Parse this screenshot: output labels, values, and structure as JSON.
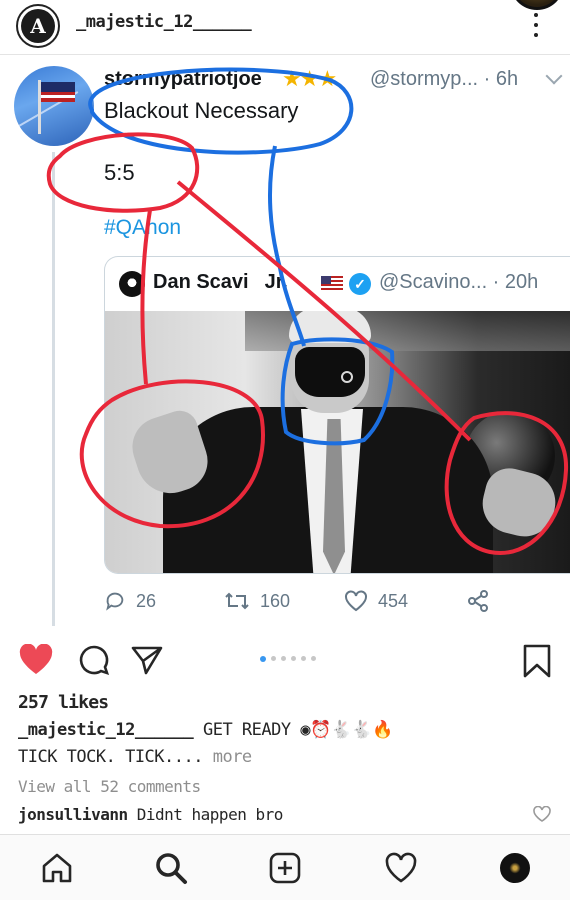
{
  "post_header": {
    "username": "_majestic_12______",
    "avatar_letter": "A"
  },
  "tweet": {
    "name": "stormypatriotjoe",
    "stars": "★★★",
    "handle_time": "@stormyp... · 6h",
    "line1": "Blackout Necessary",
    "line2": "5:5",
    "hashtag": "#QAnon",
    "quoted": {
      "name": "Dan Scavi",
      "name_suffix": "Jr.",
      "handle_time": "@Scavino... · 20h"
    },
    "actions": {
      "replies": "26",
      "retweets": "160",
      "likes": "454"
    }
  },
  "post": {
    "likes": "257 likes",
    "caption_user": "_majestic_12______",
    "caption_text": "GET READY",
    "caption_emojis": "◉⏰🐇🐇🔥",
    "caption_line2": "TICK TOCK. TICK....",
    "more": "more",
    "view_comments": "View all 52 comments",
    "comment_user": "jonsullivann",
    "comment_text": "Didnt happen bro"
  },
  "carousel": {
    "count": 6,
    "active": 0
  },
  "colors": {
    "heart_red": "#ed4956",
    "annotation_red": "#e8283a",
    "annotation_blue": "#1c6fe0",
    "link_blue": "#1b95e0",
    "star_gold": "#f4b400"
  }
}
